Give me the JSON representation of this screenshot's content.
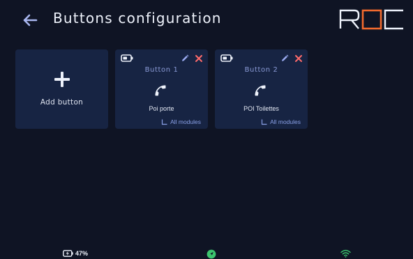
{
  "header": {
    "title": "Buttons configuration",
    "back_icon": "arrow-left-icon",
    "logo_text": "ROC"
  },
  "add_card": {
    "label": "Add button",
    "icon": "plus-icon"
  },
  "buttons": [
    {
      "name": "Button 1",
      "poi": "Poi porte",
      "modules": "All modules",
      "icon": "phone-icon"
    },
    {
      "name": "Button 2",
      "poi": "POI Toilettes",
      "modules": "All modules",
      "icon": "phone-icon"
    }
  ],
  "status_bar": {
    "battery": "47%",
    "charging": true
  },
  "colors": {
    "background": "#0f1424",
    "card": "#172443",
    "accent_blue": "#8a9ad6",
    "delete_red": "#ff6b6b",
    "logo_orange": "#f26a2e",
    "gps_green": "#3cc46e",
    "wifi_green": "#3cc46e"
  }
}
